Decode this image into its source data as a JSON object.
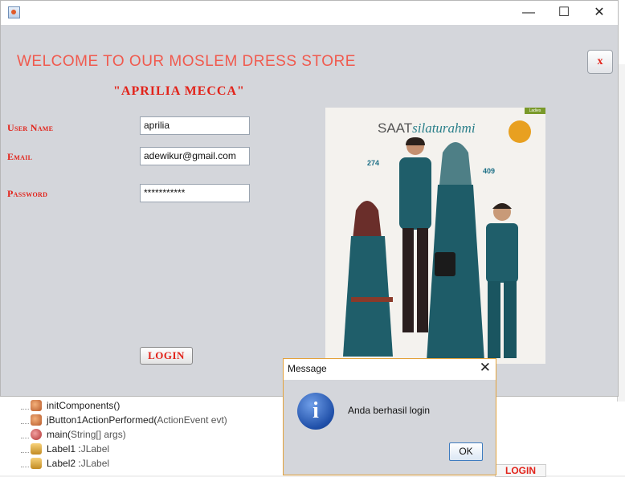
{
  "window": {
    "app_icon": "java-icon",
    "minimize": "—",
    "maximize": "☐",
    "close": "✕"
  },
  "header": {
    "welcome": "WELCOME TO OUR MOSLEM DRESS STORE",
    "store_name": "\"APRILIA MECCA\""
  },
  "form": {
    "username_label": "User Name",
    "username_value": "aprilia",
    "email_label": "Email",
    "email_value": "adewikur@gmail.com",
    "password_label": "Password",
    "password_value": "***********",
    "login_label": "LOGIN",
    "close_label": "x"
  },
  "catalog": {
    "tag": "Ladies",
    "title_plain": "SAAT",
    "title_script": "silaturahmi",
    "price_left": "274",
    "price_right": "409"
  },
  "dialog": {
    "title": "Message",
    "close": "✕",
    "message": "Anda berhasil login",
    "ok_label": "OK",
    "icon": "info-icon"
  },
  "ide": {
    "tree_items": [
      {
        "name": "initComponents()",
        "type": ""
      },
      {
        "name": "jButton1ActionPerformed(",
        "type": "ActionEvent evt)"
      },
      {
        "name": "main(",
        "type": "String[] args)"
      },
      {
        "name": "Label1 : ",
        "type": "JLabel"
      },
      {
        "name": "Label2 : ",
        "type": "JLabel"
      }
    ],
    "bg_login": "LOGIN"
  },
  "colors": {
    "accent_red": "#e2231a",
    "welcome_red": "#f05a4e",
    "panel_bg": "#d4d6db",
    "dialog_border": "#e3a23b"
  }
}
